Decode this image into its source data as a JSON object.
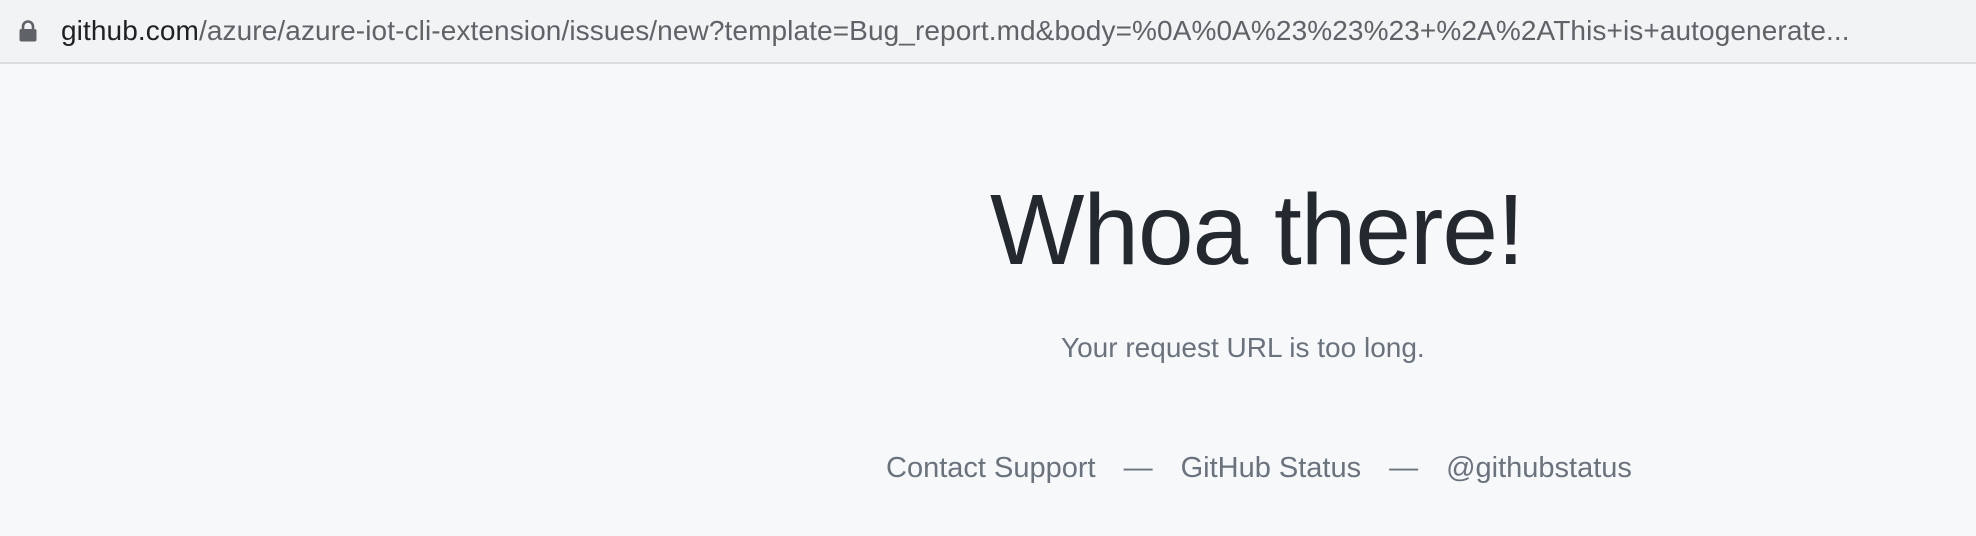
{
  "address_bar": {
    "host": "github.com",
    "path": "/azure/azure-iot-cli-extension/issues/new?template=Bug_report.md&body=%0A%0A%23%23%23+%2A%2AThis+is+autogenerate..."
  },
  "main": {
    "title": "Whoa there!",
    "message": "Your request URL is too long.",
    "links": [
      {
        "label": "Contact Support"
      },
      {
        "label": "GitHub Status"
      },
      {
        "label": "@githubstatus"
      }
    ],
    "separator": "—"
  },
  "colors": {
    "background": "#f6f8fa",
    "title": "#24292f",
    "muted": "#6a737d"
  }
}
